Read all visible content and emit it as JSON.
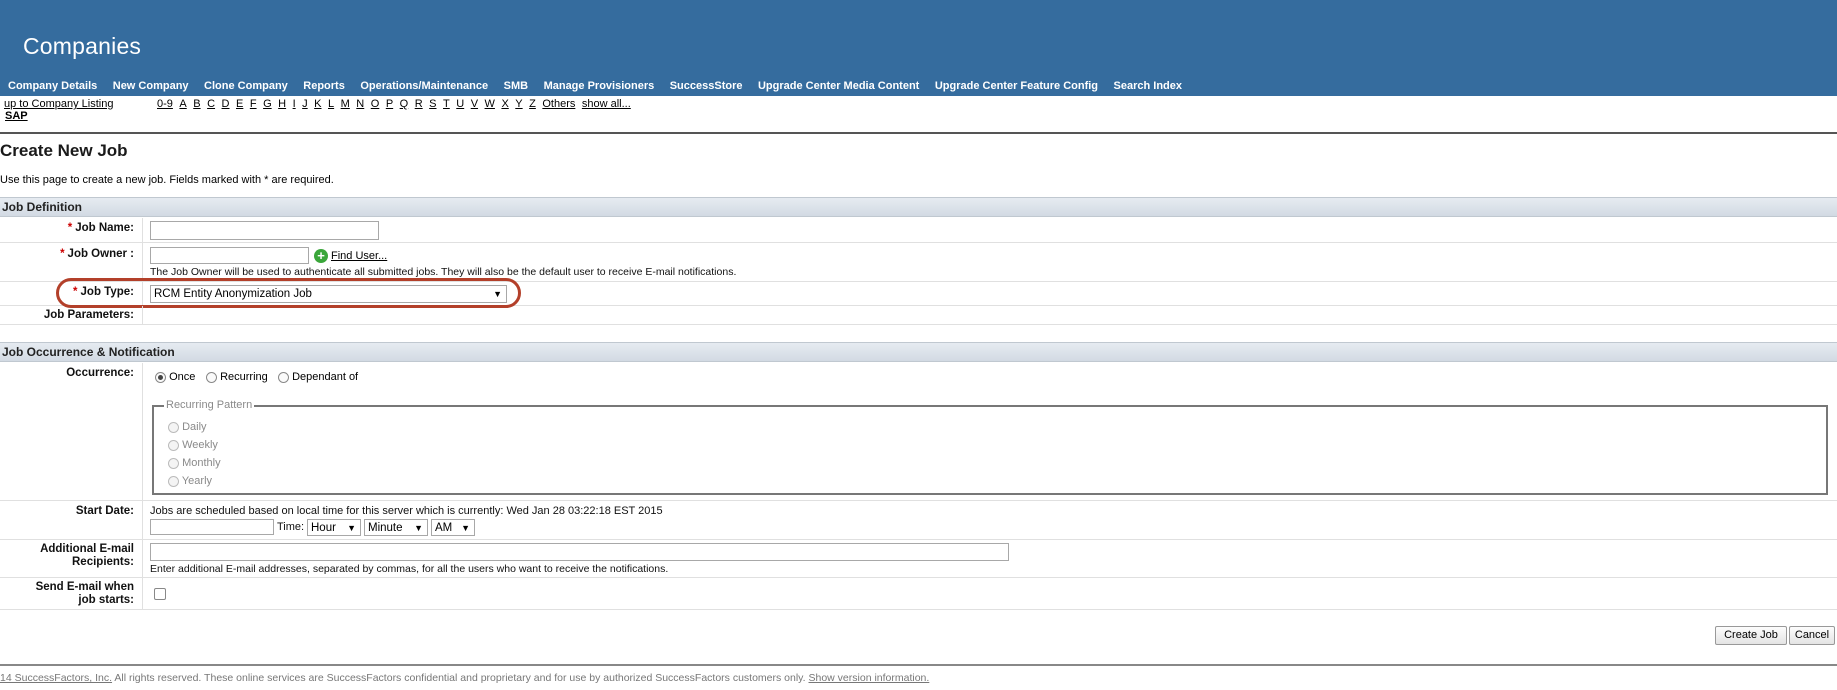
{
  "header": {
    "title": "Companies",
    "nav": [
      "Company Details",
      "New Company",
      "Clone Company",
      "Reports",
      "Operations/Maintenance",
      "SMB",
      "Manage Provisioners",
      "SuccessStore",
      "Upgrade Center Media Content",
      "Upgrade Center Feature Config",
      "Search Index"
    ]
  },
  "subnav": {
    "up_link": "up to Company Listing",
    "company_link": "SAP",
    "alpha": [
      "0-9",
      "A",
      "B",
      "C",
      "D",
      "E",
      "F",
      "G",
      "H",
      "I",
      "J",
      "K",
      "L",
      "M",
      "N",
      "O",
      "P",
      "Q",
      "R",
      "S",
      "T",
      "U",
      "V",
      "W",
      "X",
      "Y",
      "Z",
      "Others",
      "show all..."
    ]
  },
  "page": {
    "title": "Create New Job",
    "intro": "Use this page to create a new job. Fields marked with * are required."
  },
  "job_definition": {
    "section_title": "Job Definition",
    "required_mark": "*",
    "job_name_label": "Job Name:",
    "job_name_value": "",
    "job_owner_label": "Job Owner :",
    "job_owner_value": "",
    "find_user_label": "Find User...",
    "job_owner_hint": "The Job Owner will be used to authenticate all submitted jobs. They will also be the default user to receive E-mail notifications.",
    "job_type_label": "Job Type:",
    "job_type_value": "RCM Entity Anonymization Job",
    "job_params_label": "Job Parameters:"
  },
  "occurrence": {
    "section_title": "Job Occurrence & Notification",
    "occurrence_label": "Occurrence:",
    "options": [
      "Once",
      "Recurring",
      "Dependant of"
    ],
    "selected": "Once",
    "pattern_legend": "Recurring Pattern",
    "patterns": [
      "Daily",
      "Weekly",
      "Monthly",
      "Yearly"
    ],
    "start_date_label": "Start Date:",
    "start_date_hint": "Jobs are scheduled based on local time for this server which is currently: Wed Jan 28 03:22:18 EST 2015",
    "start_date_value": "",
    "time_label": "Time:",
    "hour_value": "Hour",
    "minute_value": "Minute",
    "ampm_value": "AM",
    "email_label_line1": "Additional E-mail",
    "email_label_line2": "Recipients:",
    "email_value": "",
    "email_hint": "Enter additional E-mail addresses, separated by commas, for all the users who want to receive the notifications.",
    "send_label_line1": "Send E-mail when",
    "send_label_line2": "job starts:",
    "send_checked": false
  },
  "buttons": {
    "create": "Create Job",
    "cancel": "Cancel"
  },
  "footer": {
    "copyright_link": "14 SuccessFactors, Inc.",
    "text": " All rights reserved. These online services are SuccessFactors confidential and proprietary and for use by authorized SuccessFactors customers only. ",
    "version_link": "Show version information."
  },
  "colors": {
    "header_bg": "#356c9e",
    "required": "#cc0000",
    "highlight": "#b3402a"
  }
}
